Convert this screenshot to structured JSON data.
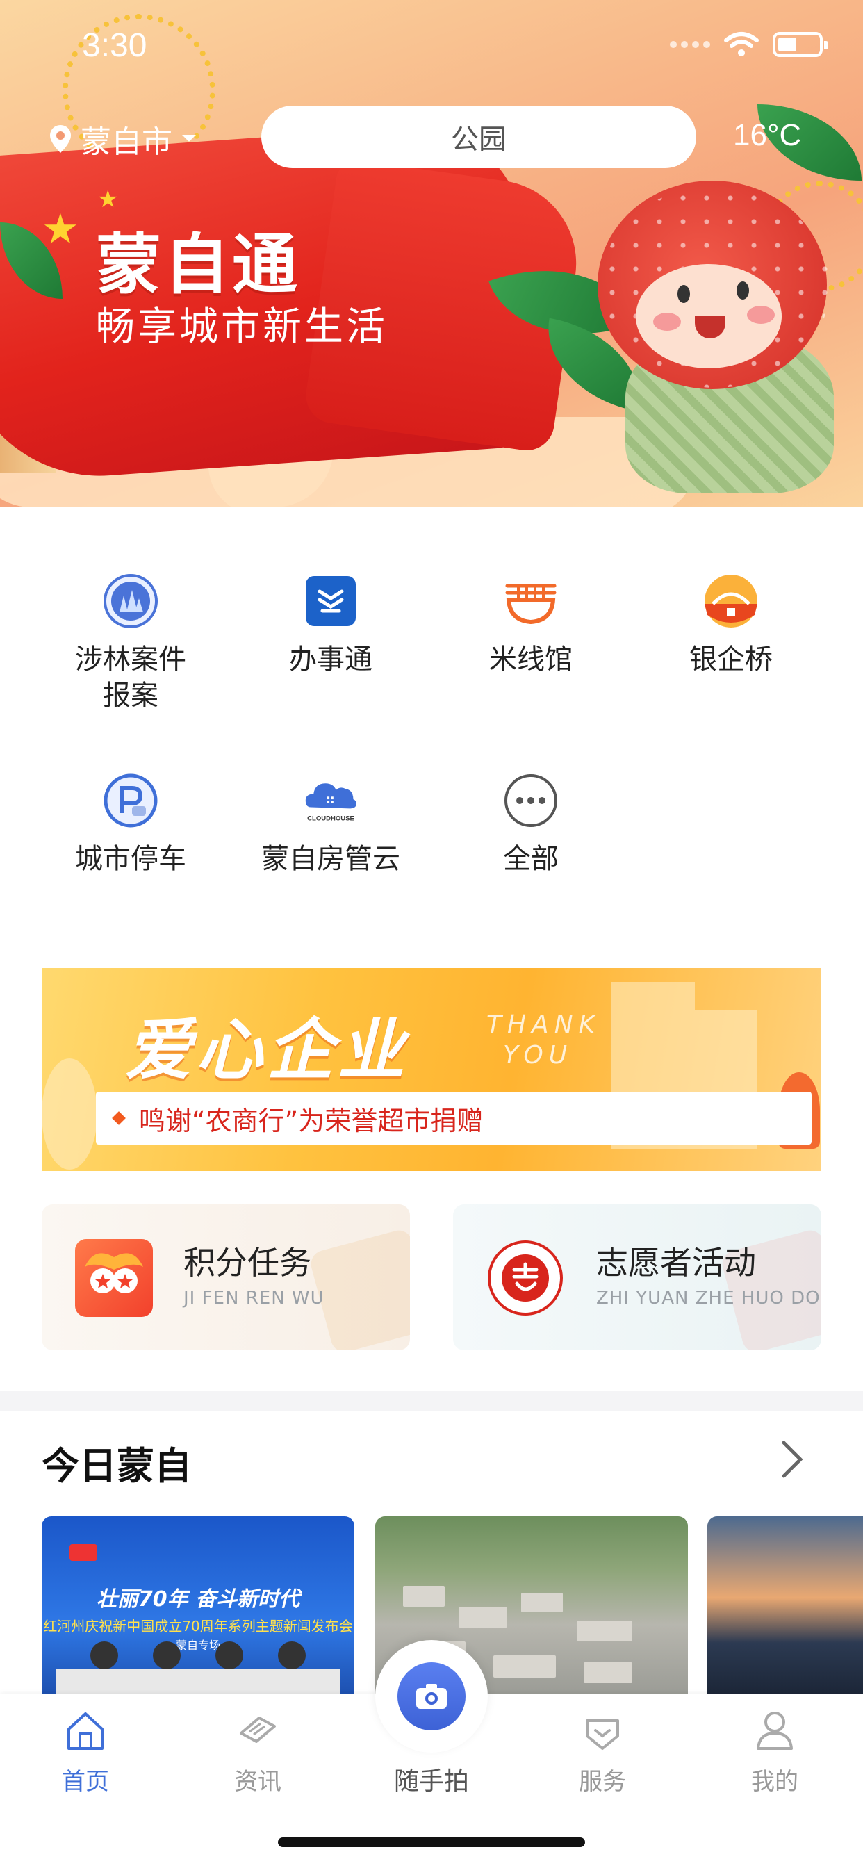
{
  "status_bar": {
    "time": "3:30"
  },
  "header": {
    "city": "蒙自市",
    "search_placeholder": "公园",
    "temperature": "16°C"
  },
  "hero": {
    "title": "蒙自通",
    "subtitle": "畅享城市新生活"
  },
  "services": [
    {
      "label": "涉林案件\n报案",
      "icon": "forest-report-icon"
    },
    {
      "label": "办事通",
      "icon": "affairs-icon"
    },
    {
      "label": "米线馆",
      "icon": "noodle-bowl-icon"
    },
    {
      "label": "银企桥",
      "icon": "bank-bridge-icon"
    },
    {
      "label": "城市停车",
      "icon": "parking-icon"
    },
    {
      "label": "蒙自房管云",
      "icon": "cloudhouse-icon"
    },
    {
      "label": "全部",
      "icon": "more-dots-icon"
    }
  ],
  "cloudhouse_logo_text": "CLOUDHOUSE",
  "promo": {
    "title": "爱心企业",
    "english": "THANK YOU",
    "english_line1": "THANK",
    "english_line2": "YOU",
    "text": "鸣谢“农商行”为荣誉超市捐赠"
  },
  "cards": [
    {
      "title": "积分任务",
      "subtitle": "JI FEN REN WU"
    },
    {
      "title": "志愿者活动",
      "subtitle": "ZHI YUAN ZHE HUO DONG"
    }
  ],
  "today": {
    "title": "今日蒙自",
    "news1_line1": "壮丽70年 奋斗新时代",
    "news1_line2": "红河州庆祝新中国成立70周年系列主题新闻发布会",
    "news1_line3": "蒙自专场"
  },
  "tabs": [
    {
      "label": "首页",
      "active": true
    },
    {
      "label": "资讯",
      "active": false
    },
    {
      "label": "随手拍",
      "active": false
    },
    {
      "label": "服务",
      "active": false
    },
    {
      "label": "我的",
      "active": false
    }
  ],
  "colors": {
    "accent": "#3f6fd8",
    "promo_red": "#d8251c",
    "icon_blue": "#3f6fd8",
    "icon_orange": "#f26a2a"
  }
}
